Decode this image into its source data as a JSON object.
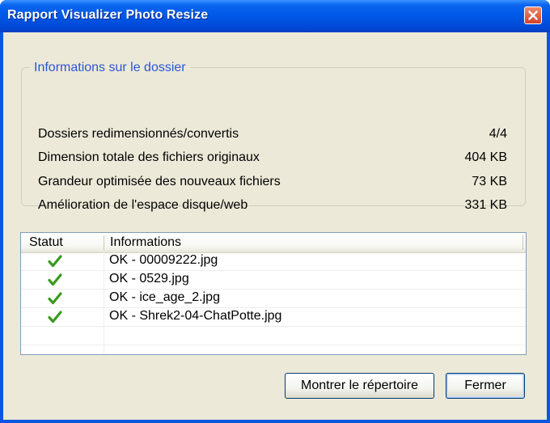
{
  "window": {
    "title": "Rapport Visualizer Photo Resize",
    "close_icon": "close-icon"
  },
  "folder_info": {
    "group_title": "Informations sur le dossier",
    "rows": [
      {
        "label": "Dossiers redimensionnés/convertis",
        "value": "4/4"
      },
      {
        "label": "Dimension totale des fichiers originaux",
        "value": "404 KB"
      },
      {
        "label": "Grandeur optimisée des nouveaux fichiers",
        "value": "73 KB"
      },
      {
        "label": "Amélioration de l'espace disque/web",
        "value": "331 KB"
      }
    ]
  },
  "results": {
    "columns": [
      "Statut",
      "Informations"
    ],
    "rows": [
      {
        "status_icon": "checkmark-icon",
        "text": "OK - 00009222.jpg"
      },
      {
        "status_icon": "checkmark-icon",
        "text": "OK - 0529.jpg"
      },
      {
        "status_icon": "checkmark-icon",
        "text": "OK - ice_age_2.jpg"
      },
      {
        "status_icon": "checkmark-icon",
        "text": "OK - Shrek2-04-ChatPotte.jpg"
      }
    ]
  },
  "buttons": {
    "show_folder": "Montrer le répertoire",
    "close": "Fermer"
  },
  "colors": {
    "titlebar": "#0058e6",
    "group_title": "#2a56d2",
    "checkmark": "#3a9a1e",
    "close_button": "#d6402a"
  }
}
